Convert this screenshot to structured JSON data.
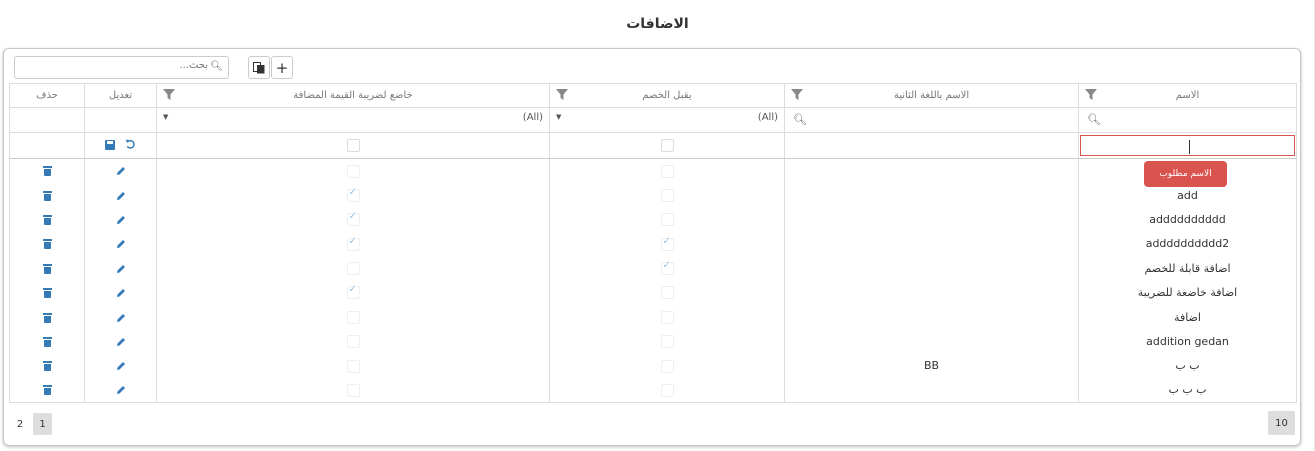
{
  "page": {
    "title": "الاضافات"
  },
  "toolbar": {
    "search_placeholder": "بحث...",
    "add_label": "+"
  },
  "columns": {
    "name": "الاسم",
    "second_lang_name": "الاسم باللغة الثانية",
    "accepts_discount": "يقبل الخصم",
    "vat_taxable": "خاضع لضريبة القيمة المضافة",
    "edit": "تعديل",
    "delete": "حذف"
  },
  "filters": {
    "accepts_discount": "(All)",
    "vat_taxable": "(All)"
  },
  "validation": {
    "message": "الاسم مطلوب"
  },
  "rows": [
    {
      "name": "",
      "second_lang_name": "",
      "accepts_discount": false,
      "vat_taxable": false
    },
    {
      "name": "add",
      "second_lang_name": "",
      "accepts_discount": false,
      "vat_taxable": true
    },
    {
      "name": "adddddddddd",
      "second_lang_name": "",
      "accepts_discount": false,
      "vat_taxable": true
    },
    {
      "name": "adddddddddd2",
      "second_lang_name": "",
      "accepts_discount": true,
      "vat_taxable": true
    },
    {
      "name": "اضافة قابلة للخصم",
      "second_lang_name": "",
      "accepts_discount": true,
      "vat_taxable": false
    },
    {
      "name": "اضافة خاضعة للضريبة",
      "second_lang_name": "",
      "accepts_discount": false,
      "vat_taxable": true
    },
    {
      "name": "اضافة",
      "second_lang_name": "",
      "accepts_discount": false,
      "vat_taxable": false
    },
    {
      "name": "addition gedan",
      "second_lang_name": "",
      "accepts_discount": false,
      "vat_taxable": false
    },
    {
      "name": "ب ب",
      "second_lang_name": "BB",
      "accepts_discount": false,
      "vat_taxable": false
    },
    {
      "name": "ب ب ب",
      "second_lang_name": "",
      "accepts_discount": false,
      "vat_taxable": false
    }
  ],
  "pager": {
    "pages": [
      "1",
      "2"
    ],
    "current_page": "1",
    "page_size": "10"
  },
  "icons": {
    "search": "search-icon",
    "filter": "filter-icon",
    "export": "export-icon",
    "add": "plus-icon",
    "edit": "pencil-icon",
    "delete": "trash-icon",
    "save": "save-icon",
    "cancel": "undo-icon"
  },
  "colors": {
    "accent": "#337ab7",
    "error": "#d9534f"
  }
}
